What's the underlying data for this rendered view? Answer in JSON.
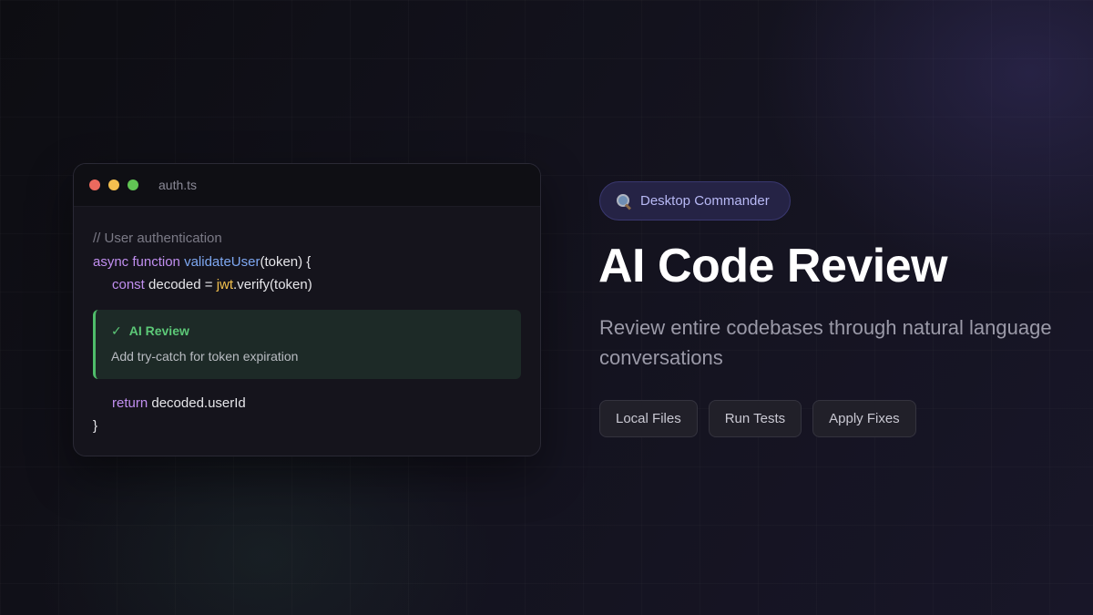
{
  "editor": {
    "filename": "auth.ts",
    "code": {
      "comment": "// User authentication",
      "async_kw": "async",
      "function_kw": "function",
      "fn_name": "validateUser",
      "fn_params": "(token) {",
      "const_kw": "const",
      "decoded_assign": "decoded =",
      "jwt_obj": "jwt",
      "verify_call": ".verify(token)",
      "return_kw": "return",
      "return_value": "decoded.userId",
      "closing_brace": "}"
    },
    "review": {
      "check": "✓",
      "title": "AI Review",
      "text": "Add try-catch for token expiration"
    }
  },
  "badge": {
    "icon": "magnifying-glass-icon",
    "label": "Desktop Commander"
  },
  "title": "AI Code Review",
  "subtitle": "Review entire codebases through natural language conversations",
  "chips": [
    "Local Files",
    "Run Tests",
    "Apply Fixes"
  ],
  "colors": {
    "keyword": "#c18ff0",
    "function": "#7ea8f2",
    "object": "#f2c14e",
    "review_accent": "#4fbd6a",
    "badge_text": "#b8b9f5"
  }
}
